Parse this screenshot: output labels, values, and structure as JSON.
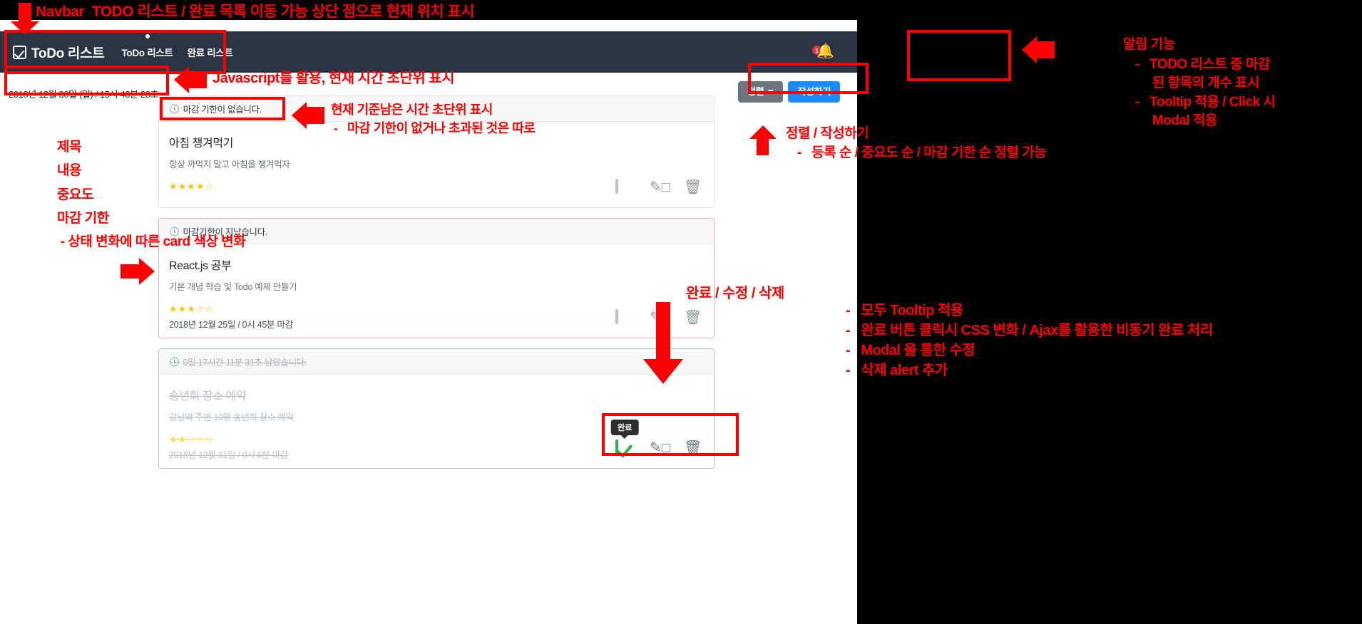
{
  "navbar": {
    "brand": "ToDo 리스트",
    "brand_icon": "checkbox-check-icon",
    "links": [
      {
        "label": "ToDo 리스트",
        "active": true
      },
      {
        "label": "완료 리스트",
        "active": false
      }
    ],
    "bell_icon": "bell-icon",
    "bell_badge": "1"
  },
  "clock": "2018년 12월 30일 (일) / 15시 48분 28초",
  "toolbar": {
    "sort_label": "정렬",
    "sort_caret_icon": "chevron-down-icon",
    "new_label": "작성하기"
  },
  "cards": [
    {
      "state": "none",
      "head": "마감 기한이 없습니다.",
      "head_icon": "clock-icon",
      "title": "아침 챙겨먹기",
      "desc": "항상 까먹지 말고 아침을 챙겨먹자",
      "stars": "★★★★☆",
      "due": "",
      "actions": {
        "complete_icon": "empty-checkbox-icon",
        "edit_icon": "pencil-square-icon",
        "delete_icon": "trash-icon"
      }
    },
    {
      "state": "overdue",
      "head": "마감기한이 지났습니다.",
      "head_icon": "clock-icon",
      "title": "React.js 공부",
      "desc": "기본 개념 학습 및 Todo 예제 만들기",
      "stars": "★★★☆☆",
      "due": "2018년 12월 25일 / 0시 45분 마감",
      "actions": {
        "complete_icon": "empty-checkbox-icon",
        "edit_icon": "pencil-square-icon",
        "delete_icon": "trash-icon"
      }
    },
    {
      "state": "done",
      "head": "0일 17시간 11분 31초 남았습니다.",
      "head_icon": "clock-icon",
      "title": "송년회 장소 예약",
      "desc": "강남역 주변 10명 송년회 장소 예약",
      "stars": "★★☆☆☆",
      "due": "2018년 12월 31일 / 0시 0분 마감",
      "tooltip": "완료",
      "actions": {
        "complete_icon": "checked-checkbox-icon",
        "edit_icon": "pencil-square-icon",
        "delete_icon": "trash-icon"
      }
    }
  ],
  "annotations": {
    "top_navbar": "Navbar  TODO 리스트 / 완료 목록 이동 가능 상단 점으로 현재 위치 표시",
    "clock_note": "Javascript를 활용, 현재 시간 초단위 표시",
    "deadline_note_1": "현재 기준남은 시간 초단위 표시",
    "deadline_note_2": "-   마감 기한이 없거나 초과된 것은 따로",
    "left_labels": "제목\n내용\n중요도\n마감 기한\n - 상태 변화에 따른 card 색상 변화",
    "bell_title": "알림 기능",
    "bell_b1": "-   TODO 리스트 중 마감\n     된 항목의 개수 표시",
    "bell_b2": "-   Tooltip 적용 / Click 시\n     Modal 적용",
    "sort_title": "정렬 / 작성하기",
    "sort_b1": "-   등록 순 / 중요도 순 / 마감 기한 순 정렬 가능",
    "actions_title": "완료 / 수정 / 삭제",
    "actions_b1": "-   모두 Tooltip 적용",
    "actions_b2": "-   완료 버튼 클릭시 CSS 변화 / Ajax를 활용한 비동기 완료 처리",
    "actions_b3": "-   Modal 을 통한 수정",
    "actions_b4": "-   삭제 alert 추가"
  },
  "colors": {
    "navbar_bg": "#2b3444",
    "primary": "#1a8cff",
    "secondary": "#6c757d",
    "danger": "#dc3545",
    "success": "#2fb344",
    "star": "#ffc107",
    "annotation": "#ff0000"
  }
}
